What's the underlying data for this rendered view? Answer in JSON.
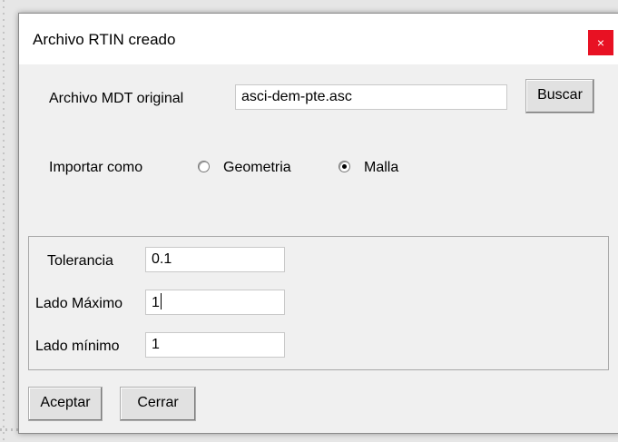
{
  "dialog": {
    "title": "Archivo RTIN creado",
    "close_glyph": "×"
  },
  "file": {
    "label": "Archivo MDT original",
    "value": "asci-dem-pte.asc",
    "browse_label": "Buscar"
  },
  "import_as": {
    "label": "Importar como",
    "options": [
      {
        "label": "Geometria",
        "selected": false
      },
      {
        "label": "Malla",
        "selected": true
      }
    ]
  },
  "params": {
    "tolerance_label": "Tolerancia",
    "tolerance_value": "0.1",
    "max_side_label": "Lado Máximo",
    "max_side_value": "1",
    "min_side_label": "Lado mínimo",
    "min_side_value": "1"
  },
  "buttons": {
    "accept_label": "Aceptar",
    "close_label": "Cerrar"
  },
  "colors": {
    "close_button": "#e81123",
    "dialog_body": "#f0f0f0"
  }
}
